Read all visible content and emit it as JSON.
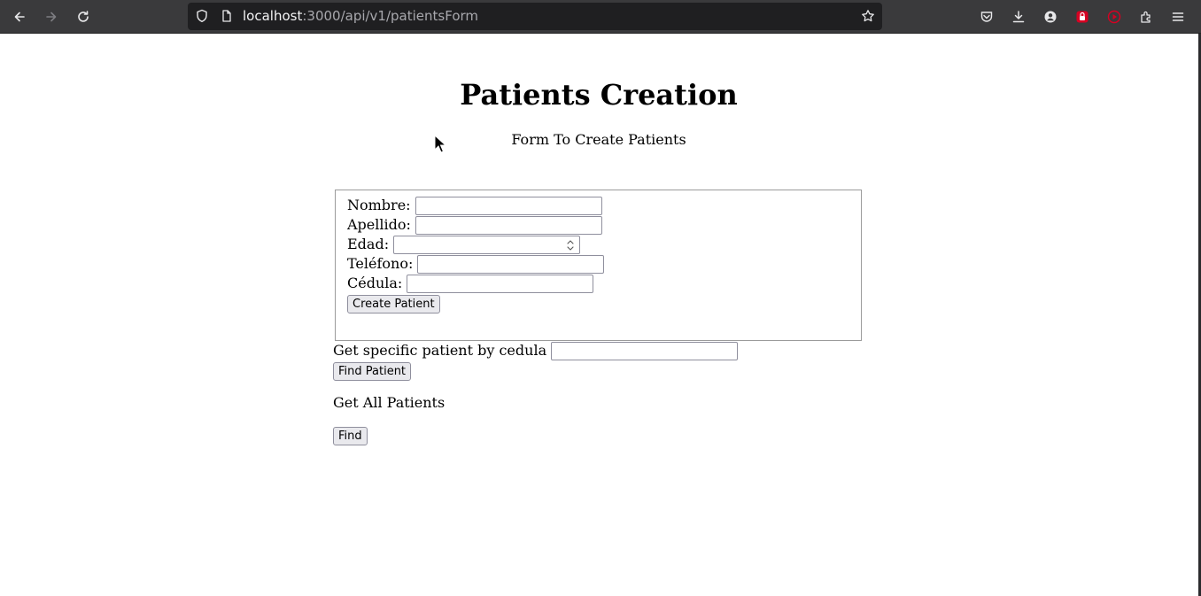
{
  "browser": {
    "url_host": "localhost",
    "url_path": ":3000/api/v1/patientsForm"
  },
  "page": {
    "title": "Patients Creation",
    "subtitle": "Form To Create Patients"
  },
  "create_form": {
    "fields": [
      {
        "label": "Nombre:",
        "value": ""
      },
      {
        "label": "Apellido:",
        "value": ""
      },
      {
        "label": "Edad:",
        "value": ""
      },
      {
        "label": "Teléfono:",
        "value": ""
      },
      {
        "label": "Cédula:",
        "value": ""
      }
    ],
    "submit_label": "Create Patient"
  },
  "find_by_cedula": {
    "label": "Get specific patient by cedula",
    "value": "",
    "button_label": "Find Patient"
  },
  "get_all": {
    "label": "Get All Patients",
    "button_label": "Find"
  }
}
